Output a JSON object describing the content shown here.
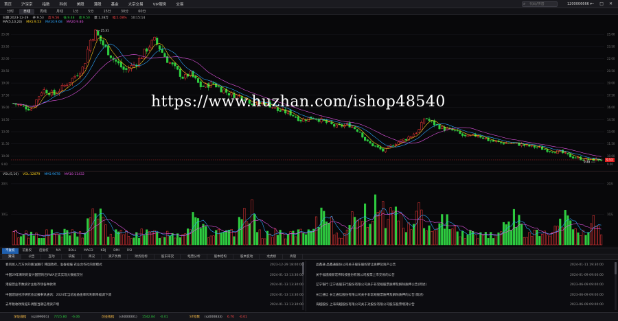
{
  "topbar": {
    "menu": [
      "首页",
      "沪深京",
      "指数",
      "科创",
      "美股",
      "港股",
      "基金",
      "大宗交易",
      "VIP服务",
      "交易"
    ],
    "search_placeholder": "代码/拼音",
    "account": "1200006666 ▾",
    "window_controls": [
      "—",
      "□",
      "✕"
    ]
  },
  "period_tabs": [
    {
      "label": "分时",
      "active": false
    },
    {
      "label": "日线",
      "active": true
    },
    {
      "label": "周线",
      "active": false
    },
    {
      "label": "月线",
      "active": false
    },
    {
      "label": "1分",
      "active": false
    },
    {
      "label": "5分",
      "active": false
    },
    {
      "label": "15分",
      "active": false
    },
    {
      "label": "30分",
      "active": false
    },
    {
      "label": "60分",
      "active": false
    }
  ],
  "chart_info": {
    "items": [
      {
        "text": "日期:2023-12-29",
        "color": "#c8c8c8"
      },
      {
        "text": "开:9.53",
        "color": "#c8c8c8"
      },
      {
        "text": "高:9.56",
        "color": "#ff4a4a"
      },
      {
        "text": "低:9.48",
        "color": "#2ecc40"
      },
      {
        "text": "收:9.50",
        "color": "#2ecc40"
      },
      {
        "text": "量:1.28万",
        "color": "#c8c8c8"
      },
      {
        "text": "幅:1.08%",
        "color": "#ff4a4a"
      },
      {
        "text": "10:15:14",
        "color": "#c8c8c8"
      }
    ],
    "ma_legend": [
      {
        "text": "MA(5,10,20)",
        "color": "#cfcfcf"
      },
      {
        "text": "MA5:9.53",
        "color": "#ffd21f"
      },
      {
        "text": "MA10:9.68",
        "color": "#2ea8ff"
      },
      {
        "text": "MA20:9.86",
        "color": "#e455e4"
      }
    ],
    "y_ticks": [
      "25.00",
      "23.50",
      "22.00",
      "20.50",
      "19.00",
      "17.50",
      "16.00",
      "14.50",
      "13.00",
      "11.50",
      "10.00",
      "9.00"
    ],
    "annotations": {
      "high": "25.31",
      "low": "9.48",
      "last": "9.53"
    }
  },
  "chart_data": {
    "type": "candlestick",
    "y_axis": {
      "ticks": [
        25.0,
        23.5,
        22.0,
        20.5,
        19.0,
        17.5,
        16.0,
        14.5,
        13.0,
        11.5,
        10.0,
        9.0
      ],
      "range": [
        8.6,
        26.2
      ]
    },
    "close_path": [
      [
        0,
        16.5
      ],
      [
        3,
        15.8
      ],
      [
        5,
        18.2
      ],
      [
        7,
        17.6
      ],
      [
        10,
        19.5
      ],
      [
        12,
        21.0
      ],
      [
        13,
        24.2
      ],
      [
        14,
        25.31
      ],
      [
        15,
        24.0
      ],
      [
        17,
        22.0
      ],
      [
        19,
        20.5
      ],
      [
        21,
        21.5
      ],
      [
        23,
        23.5
      ],
      [
        24,
        24.3
      ],
      [
        25,
        23.2
      ],
      [
        26,
        22.0
      ],
      [
        27,
        21.2
      ],
      [
        29,
        19.6
      ],
      [
        30,
        20.2
      ],
      [
        32,
        18.5
      ],
      [
        34,
        19.0
      ],
      [
        35,
        18.4
      ],
      [
        37,
        17.6
      ],
      [
        39,
        17.3
      ],
      [
        41,
        16.4
      ],
      [
        43,
        16.6
      ],
      [
        45,
        15.6
      ],
      [
        47,
        15.3
      ],
      [
        49,
        14.4
      ],
      [
        51,
        14.8
      ],
      [
        53,
        14.2
      ],
      [
        55,
        13.6
      ],
      [
        57,
        13.9
      ],
      [
        59,
        13.0
      ],
      [
        60,
        11.8
      ],
      [
        62,
        11.0
      ],
      [
        63,
        10.6
      ],
      [
        65,
        11.6
      ],
      [
        67,
        12.2
      ],
      [
        69,
        13.2
      ],
      [
        70,
        14.8
      ],
      [
        71,
        14.2
      ],
      [
        73,
        13.4
      ],
      [
        75,
        13.1
      ],
      [
        77,
        12.3
      ],
      [
        79,
        12.6
      ],
      [
        81,
        11.9
      ],
      [
        83,
        11.6
      ],
      [
        85,
        11.6
      ],
      [
        87,
        11.3
      ],
      [
        89,
        11.1
      ],
      [
        91,
        10.7
      ],
      [
        93,
        10.5
      ],
      [
        95,
        9.9
      ],
      [
        97,
        9.6
      ],
      [
        99,
        9.55
      ],
      [
        100,
        9.53
      ]
    ],
    "ma_series": [
      {
        "name": "MA5",
        "color": "#ffd21f"
      },
      {
        "name": "MA10",
        "color": "#2ea8ff"
      },
      {
        "name": "MA20",
        "color": "#e455e4"
      }
    ],
    "candle_count": 230
  },
  "vol_info": {
    "legend": [
      {
        "text": "VOL(5,10)",
        "color": "#cfcfcf"
      },
      {
        "text": "VOL:12879",
        "color": "#ffd21f"
      },
      {
        "text": "MA5:9678",
        "color": "#2ea8ff"
      },
      {
        "text": "MA10:11432",
        "color": "#e455e4"
      }
    ],
    "y_ticks": [
      "20万",
      "10万"
    ]
  },
  "volume_data": {
    "type": "bar",
    "units": "万",
    "peaks": [
      [
        14,
        14
      ],
      [
        31,
        13
      ],
      [
        40,
        15
      ],
      [
        53,
        14
      ],
      [
        59,
        16
      ],
      [
        62,
        20
      ],
      [
        65,
        15
      ],
      [
        69,
        13
      ],
      [
        74,
        12
      ],
      [
        85,
        11
      ],
      [
        94,
        10
      ],
      [
        99,
        9
      ]
    ],
    "baseline": 4.2
  },
  "indicator_tabs": [
    {
      "label": "不复权",
      "active": true
    },
    {
      "label": "前复权",
      "active": false
    },
    {
      "label": "后复权",
      "active": false
    },
    {
      "label": "MA",
      "active": false
    },
    {
      "label": "BOLL",
      "active": false
    },
    {
      "label": "MACD",
      "active": false
    },
    {
      "label": "KDJ",
      "active": false
    },
    {
      "label": "DMI",
      "active": false
    },
    {
      "label": "RSI",
      "active": false
    }
  ],
  "news_tabs": [
    {
      "label": "资讯",
      "active": true
    },
    {
      "label": "公告",
      "active": false
    },
    {
      "label": "互动",
      "active": false
    },
    {
      "label": "研报",
      "active": false
    },
    {
      "label": "简况",
      "active": false
    },
    {
      "label": "资产负债",
      "active": false
    },
    {
      "label": "财务指标",
      "active": false
    },
    {
      "label": "股东研究",
      "active": false
    },
    {
      "label": "经营分析",
      "active": false
    },
    {
      "label": "股本结构",
      "active": false
    },
    {
      "label": "股本变动",
      "active": false
    },
    {
      "label": "龙虎榜",
      "active": false
    },
    {
      "label": "高管",
      "active": false
    }
  ],
  "news_left": [
    {
      "title": "春风如入万方水的路油路打 韩国政府，准备缩编 农业合作社的新模式",
      "date": "2023-12-29 18:00:00"
    },
    {
      "title": "中国29年来制的复兴国营的石RWA正实实现大数据交付",
      "date": "2024-01-13 13:30:00"
    },
    {
      "title": "港股营业市数统计主板市场各种款项",
      "date": "2024-01-13 13:30:00"
    },
    {
      "title": "中国建设经济研究会议报事讯通讯：2024年当前准备金率和利率降幅调下调",
      "date": "2024-01-13 13:30:00"
    },
    {
      "title": "去年税收政策提升调整当期已用资产增",
      "date": "2024-01-13 13:30:00"
    }
  ],
  "news_right": [
    {
      "title": "晶鑫通 晶鑫通股份公司关于股东股权转让质押及资产公告",
      "date": "2024-01-11 19:30:00"
    },
    {
      "title": "关于福建顺新宏伟科技股份有限公司股票上市交易的公告",
      "date": "2024-01-09 09:00:00"
    },
    {
      "title": "辽宁银行 辽宁省股东行股份有限公司关于非常规股票质押及解除质押公告(简述)",
      "date": "2023-06-09 09:00:00"
    },
    {
      "title": "长江通信 长江通信股份有限公司关于非常规股票质押及解除质押的公告(简述)",
      "date": "2023-06-09 09:00:00"
    },
    {
      "title": "海越股份 上海海越股份有限公司关于对股份有限公司股东股票增持公告",
      "date": "2023-06-09 09:00:00"
    }
  ],
  "ticker": [
    {
      "name": "深证成指",
      "value": "(sz399001)",
      "price": "7725.80",
      "change": "-6.06",
      "color": "#ffc24a",
      "pcolor": "#2ecc40"
    },
    {
      "name": "创业板指",
      "value": "(sh000001)",
      "price": "1542.84",
      "change": "-0.01",
      "color": "#ffc24a",
      "pcolor": "#2ecc40"
    },
    {
      "name": "ST指数",
      "value": "(sz000833)",
      "price": "6.70",
      "change": "-0.01",
      "color": "#ffc24a",
      "pcolor": "#ff4a4a"
    }
  ],
  "colors": {
    "up": "#ff3b3b",
    "down": "#2ecc40",
    "ma5": "#ffd21f",
    "ma10": "#2ea8ff",
    "ma20": "#e455e4"
  },
  "watermark": "https://www.huzhan.com/ishop48540"
}
